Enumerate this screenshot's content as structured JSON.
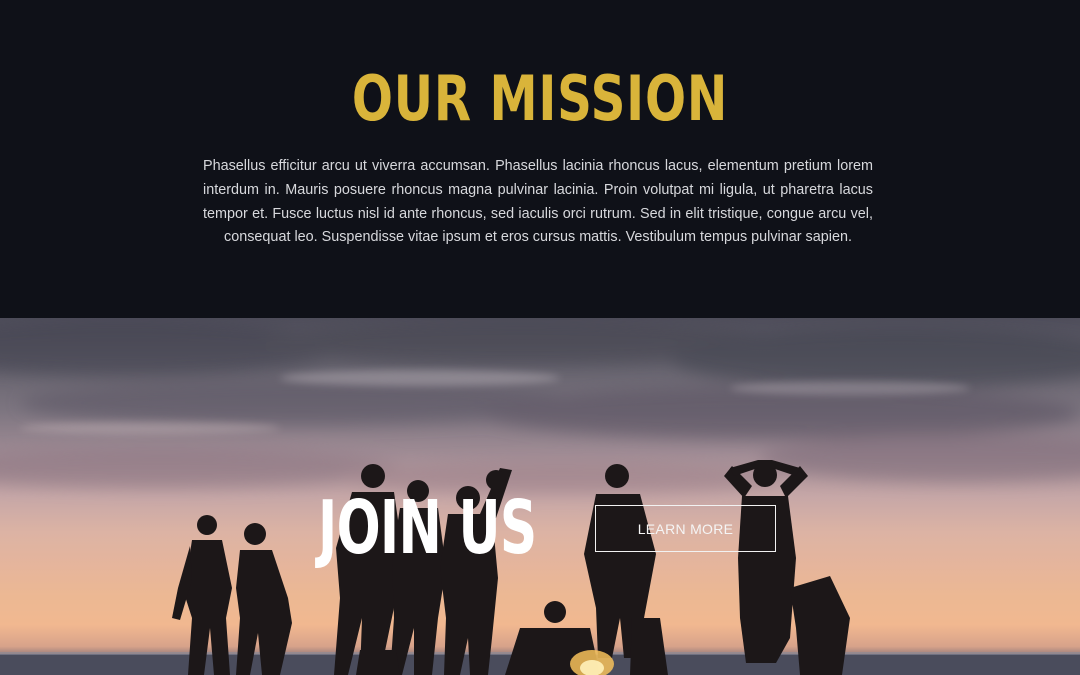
{
  "mission": {
    "title": "OUR MISSION",
    "body": "Phasellus efficitur arcu ut viverra accumsan. Phasellus lacinia rhoncus lacus, elementum pretium lorem interdum in. Mauris posuere rhoncus magna pulvinar lacinia. Proin volutpat mi ligula, ut pharetra lacus tempor et. Fusce luctus nisl id ante rhoncus, sed iaculis orci rutrum. Sed in elit tristique, congue arcu vel, consequat leo. Suspendisse vitae ipsum et eros cursus mattis. Vestibulum tempus pulvinar sapien."
  },
  "join": {
    "title": "JOIN US",
    "button_label": "LEARN MORE",
    "background_image": "sunset-beach-group-silhouette"
  },
  "colors": {
    "accent": "#d9b43a",
    "dark_background": "#0f1118",
    "body_text": "#d7d8dc"
  }
}
